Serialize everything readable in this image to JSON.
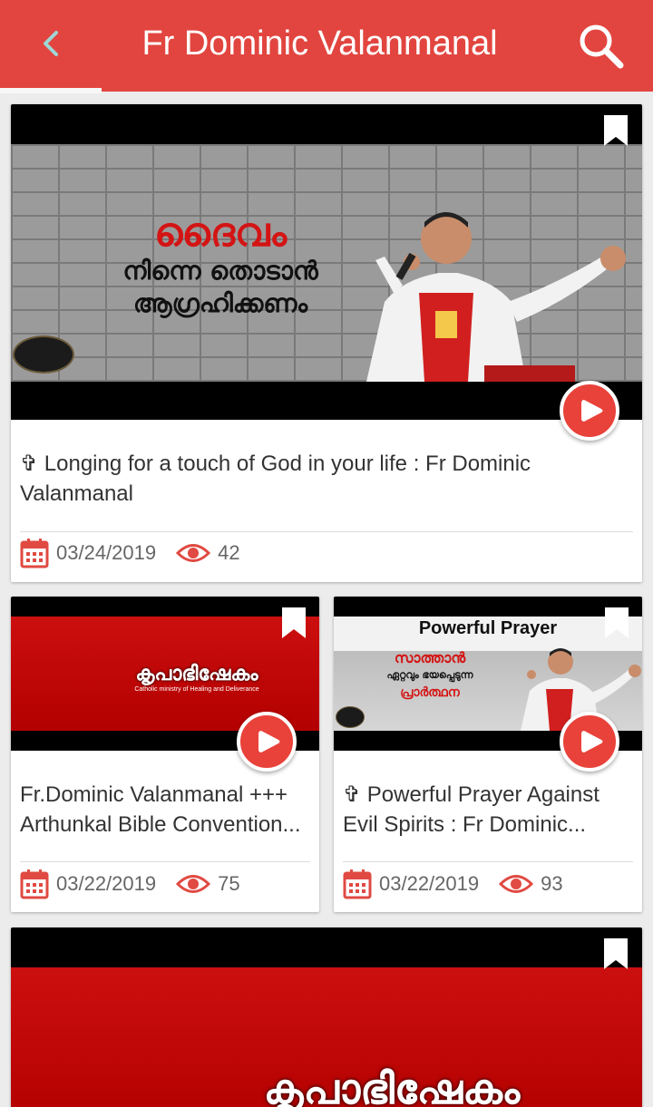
{
  "appbar": {
    "title": "Fr Dominic Valanmanal",
    "back_icon": "back-arrow-icon",
    "search_icon": "search-icon"
  },
  "colors": {
    "primary": "#e2453f",
    "accent_red": "#e9423a",
    "text": "#333333",
    "meta": "#666666"
  },
  "videos": [
    {
      "title": "✞ Longing for a touch of God in your life : Fr Dominic Valanmanal",
      "date": "03/24/2019",
      "views": "42",
      "thumb_caption": [
        "ദൈവം",
        "നിന്നെ തൊടാൻ",
        "ആഗ്രഹിക്കണം"
      ]
    },
    {
      "title": "Fr.Dominic Valanmanal +++ Arthunkal Bible Convention...",
      "date": "03/22/2019",
      "views": "75",
      "thumb_caption": [
        "കൃപാഭിഷേകം",
        "Catholic ministry of Healing and Deliverance"
      ]
    },
    {
      "title": "✞ Powerful Prayer Against Evil Spirits : Fr Dominic...",
      "date": "03/22/2019",
      "views": "93",
      "thumb_caption": [
        "Powerful Prayer",
        "സാത്താൻ",
        "ഏറ്റവും ഭയപ്പെടുന്ന",
        "പ്രാർത്ഥന"
      ]
    },
    {
      "thumb_caption": [
        "കൃപാഭിഷേകം"
      ]
    }
  ]
}
